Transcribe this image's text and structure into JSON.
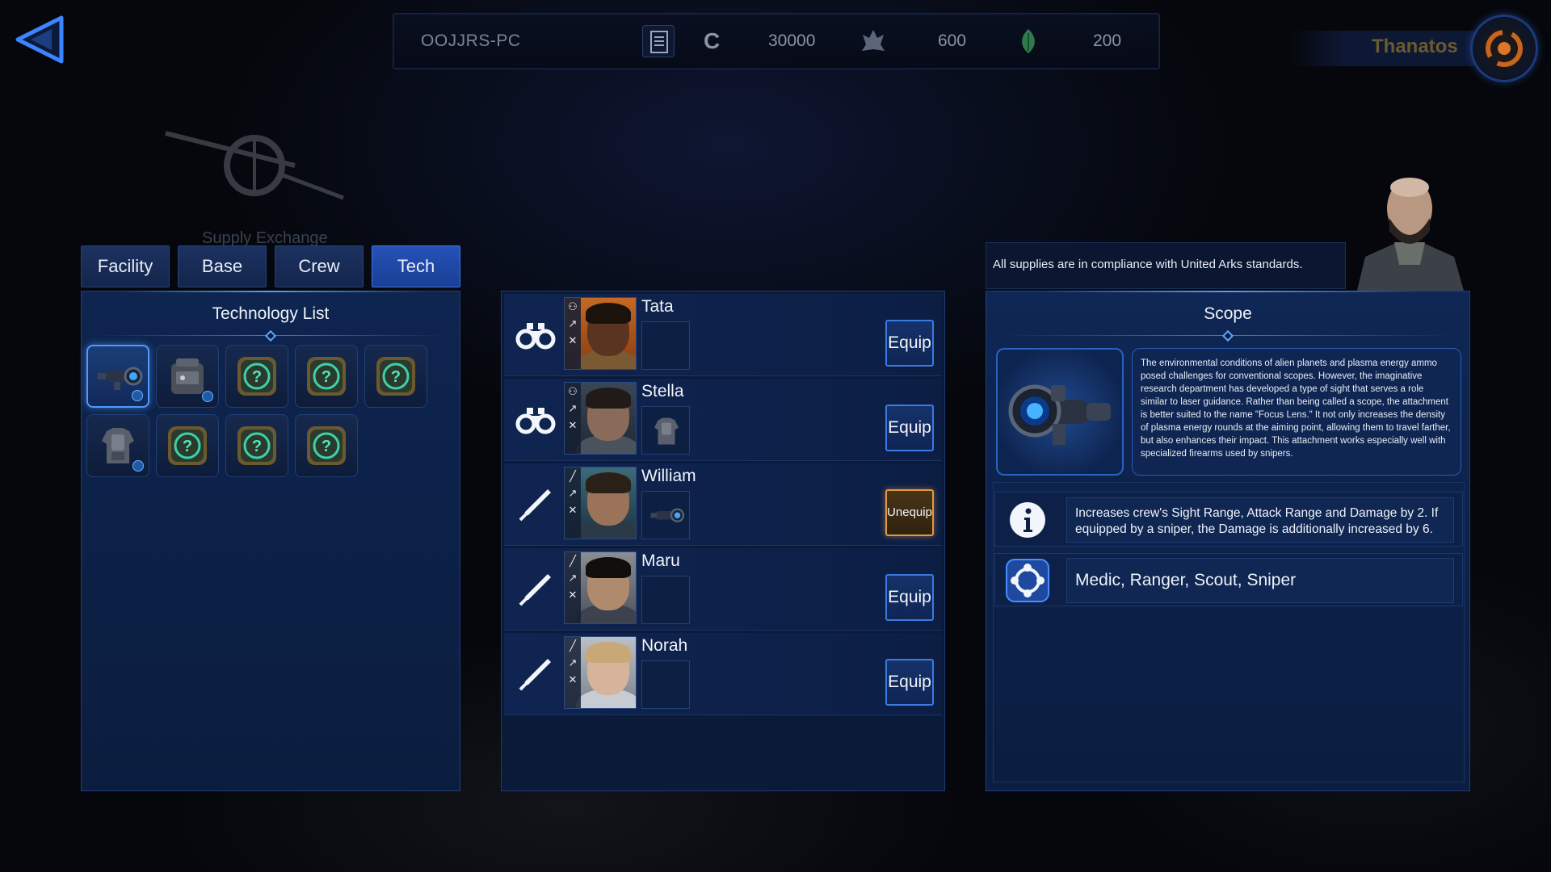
{
  "header": {
    "pc_name": "OOJJRS-PC",
    "credit_symbol": "C",
    "credits": "30000",
    "crystals": "600",
    "bio": "200",
    "player_name": "Thanatos"
  },
  "supply_label": "Supply Exchange",
  "tabs": [
    {
      "label": "Facility",
      "active": false
    },
    {
      "label": "Base",
      "active": false
    },
    {
      "label": "Crew",
      "active": false
    },
    {
      "label": "Tech",
      "active": true
    }
  ],
  "tech_list": {
    "title": "Technology List",
    "items": [
      {
        "icon": "scope-icon",
        "selected": true,
        "equipped_badge": true
      },
      {
        "icon": "backpack-icon",
        "selected": false,
        "equipped_badge": true
      },
      {
        "icon": "unknown-tech-icon",
        "selected": false,
        "equipped_badge": false
      },
      {
        "icon": "unknown-tech-icon",
        "selected": false,
        "equipped_badge": false
      },
      {
        "icon": "unknown-tech-icon",
        "selected": false,
        "equipped_badge": false
      },
      {
        "icon": "armor-icon",
        "selected": false,
        "equipped_badge": true
      },
      {
        "icon": "unknown-tech-icon",
        "selected": false,
        "equipped_badge": false
      },
      {
        "icon": "unknown-tech-icon",
        "selected": false,
        "equipped_badge": false
      },
      {
        "icon": "unknown-tech-icon",
        "selected": false,
        "equipped_badge": false
      }
    ]
  },
  "crew": [
    {
      "name": "Tata",
      "role_icon": "binoculars-icon",
      "equipped": "",
      "button": "Equip"
    },
    {
      "name": "Stella",
      "role_icon": "binoculars-icon",
      "equipped": "armor-icon",
      "button": "Equip"
    },
    {
      "name": "William",
      "role_icon": "bullet-icon",
      "equipped": "scope-icon",
      "button": "Unequip"
    },
    {
      "name": "Maru",
      "role_icon": "bullet-icon",
      "equipped": "",
      "button": "Equip"
    },
    {
      "name": "Norah",
      "role_icon": "bullet-icon",
      "equipped": "",
      "button": "Equip"
    }
  ],
  "npc_message": "All supplies are in compliance with United Arks standards.",
  "detail": {
    "title": "Scope",
    "description": "The environmental conditions of alien planets and plasma energy ammo posed challenges for conventional scopes. However, the imaginative research department has developed a type of sight that serves a role similar to laser guidance. Rather than being called a scope, the attachment is better suited to the name \"Focus Lens.\" It not only increases the density of plasma energy rounds at the aiming point, allowing them to travel farther, but also enhances their impact. This attachment works especially well with specialized firearms used by snipers.",
    "effect": "Increases crew's Sight Range, Attack Range and Damage by 2. If equipped by a sniper, the Damage is additionally increased by 6.",
    "classes": "Medic, Ranger, Scout, Sniper"
  },
  "colors": {
    "accent": "#3b7ae0",
    "tab_active": "#2552b8",
    "unequip": "#e29a3c"
  }
}
